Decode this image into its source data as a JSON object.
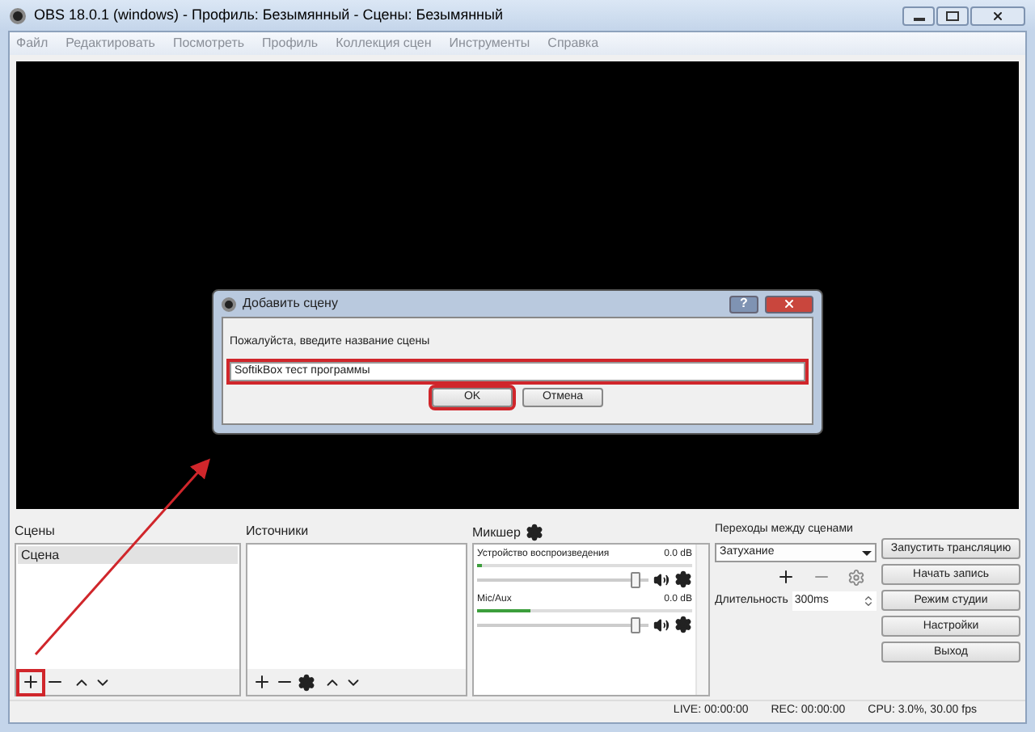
{
  "window": {
    "title": "OBS 18.0.1 (windows) - Профиль: Безымянный - Сцены: Безымянный"
  },
  "menu": [
    "Файл",
    "Редактировать",
    "Посмотреть",
    "Профиль",
    "Коллекция сцен",
    "Инструменты",
    "Справка"
  ],
  "dialog": {
    "title": "Добавить сцену",
    "help": "?",
    "prompt": "Пожалуйста, введите название сцены",
    "value": "SoftikBox тест программы",
    "highlighted": true,
    "buttons": [
      {
        "label": "OK",
        "highlighted": true
      },
      {
        "label": "Отмена",
        "highlighted": false
      }
    ]
  },
  "scenes": {
    "title": "Сцены",
    "add_highlighted": true,
    "items": [
      {
        "label": "Сцена",
        "selected": true
      }
    ]
  },
  "sources": {
    "title": "Источники"
  },
  "mixer": {
    "title": "Микшер",
    "channels": [
      {
        "name": "Устройство воспроизведения",
        "reading": "0.0 dB",
        "meter": {
          "level": 0.02
        },
        "level": 0.95
      },
      {
        "name": "Mic/Aux",
        "reading": "0.0 dB",
        "meter": {
          "level": 0.25
        },
        "level": 0.95
      }
    ]
  },
  "transitions": {
    "title": "Переходы между сценами",
    "value": "Затухание",
    "duration_label": "Длительность",
    "duration": "300ms"
  },
  "controls": [
    "Запустить трансляцию",
    "Начать запись",
    "Режим студии",
    "Настройки",
    "Выход"
  ],
  "status_bar": [
    "LIVE: 00:00:00",
    "REC: 00:00:00",
    "CPU: 3.0%, 30.00 fps"
  ]
}
